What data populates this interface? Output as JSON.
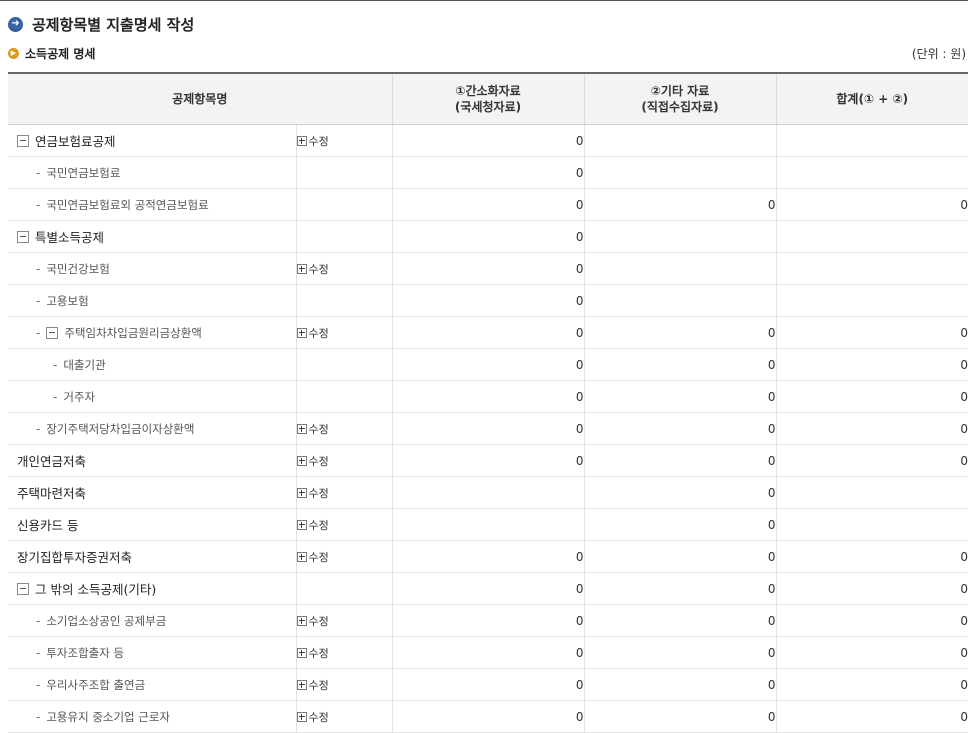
{
  "page": {
    "title": "공제항목별 지출명세 작성",
    "section_title": "소득공제 명세",
    "unit_label": "(단위 : 원)"
  },
  "table": {
    "headers": {
      "item": "공제항목명",
      "col1_line1": "①간소화자료",
      "col1_line2": "(국세청자료)",
      "col2_line1": "②기타 자료",
      "col2_line2": "(직접수집자료)",
      "total": "합계(① + ②)"
    },
    "edit_label": "수정",
    "rows": [
      {
        "label": "연금보험료공제",
        "level": 0,
        "toggle": true,
        "edit": true,
        "v1": "0",
        "v2": "",
        "total": ""
      },
      {
        "label": "국민연금보험료",
        "level": 1,
        "toggle": false,
        "edit": false,
        "v1": "0",
        "v2": "",
        "total": ""
      },
      {
        "label": "국민연금보험료외 공적연금보험료",
        "level": 1,
        "toggle": false,
        "edit": false,
        "v1": "0",
        "v2": "0",
        "total": "0"
      },
      {
        "label": "특별소득공제",
        "level": 0,
        "toggle": true,
        "edit": false,
        "v1": "0",
        "v2": "",
        "total": ""
      },
      {
        "label": "국민건강보험",
        "level": 1,
        "toggle": false,
        "edit": true,
        "v1": "0",
        "v2": "",
        "total": ""
      },
      {
        "label": "고용보험",
        "level": 1,
        "toggle": false,
        "edit": false,
        "v1": "0",
        "v2": "",
        "total": ""
      },
      {
        "label": "주택임차차입금원리금상환액",
        "level": 1,
        "toggle": true,
        "edit": true,
        "v1": "0",
        "v2": "0",
        "total": "0"
      },
      {
        "label": "대출기관",
        "level": 2,
        "toggle": false,
        "edit": false,
        "v1": "0",
        "v2": "0",
        "total": "0"
      },
      {
        "label": "거주자",
        "level": 2,
        "toggle": false,
        "edit": false,
        "v1": "0",
        "v2": "0",
        "total": "0"
      },
      {
        "label": "장기주택저당차입금이자상환액",
        "level": 1,
        "toggle": false,
        "edit": true,
        "v1": "0",
        "v2": "0",
        "total": "0"
      },
      {
        "label": "개인연금저축",
        "level": 0,
        "toggle": false,
        "edit": true,
        "v1": "0",
        "v2": "0",
        "total": "0"
      },
      {
        "label": "주택마련저축",
        "level": 0,
        "toggle": false,
        "edit": true,
        "v1": "",
        "v2": "0",
        "total": ""
      },
      {
        "label": "신용카드 등",
        "level": 0,
        "toggle": false,
        "edit": true,
        "v1": "",
        "v2": "0",
        "total": ""
      },
      {
        "label": "장기집합투자증권저축",
        "level": 0,
        "toggle": false,
        "edit": true,
        "v1": "0",
        "v2": "0",
        "total": "0"
      },
      {
        "label": "그 밖의 소득공제(기타)",
        "level": 0,
        "toggle": true,
        "edit": false,
        "v1": "0",
        "v2": "0",
        "total": "0"
      },
      {
        "label": "소기업소상공인 공제부금",
        "level": 1,
        "toggle": false,
        "edit": true,
        "v1": "0",
        "v2": "0",
        "total": "0"
      },
      {
        "label": "투자조합출자 등",
        "level": 1,
        "toggle": false,
        "edit": true,
        "v1": "0",
        "v2": "0",
        "total": "0"
      },
      {
        "label": "우리사주조합 출연금",
        "level": 1,
        "toggle": false,
        "edit": true,
        "v1": "0",
        "v2": "0",
        "total": "0"
      },
      {
        "label": "고용유지 중소기업 근로자",
        "level": 1,
        "toggle": false,
        "edit": true,
        "v1": "0",
        "v2": "0",
        "total": "0"
      }
    ]
  }
}
